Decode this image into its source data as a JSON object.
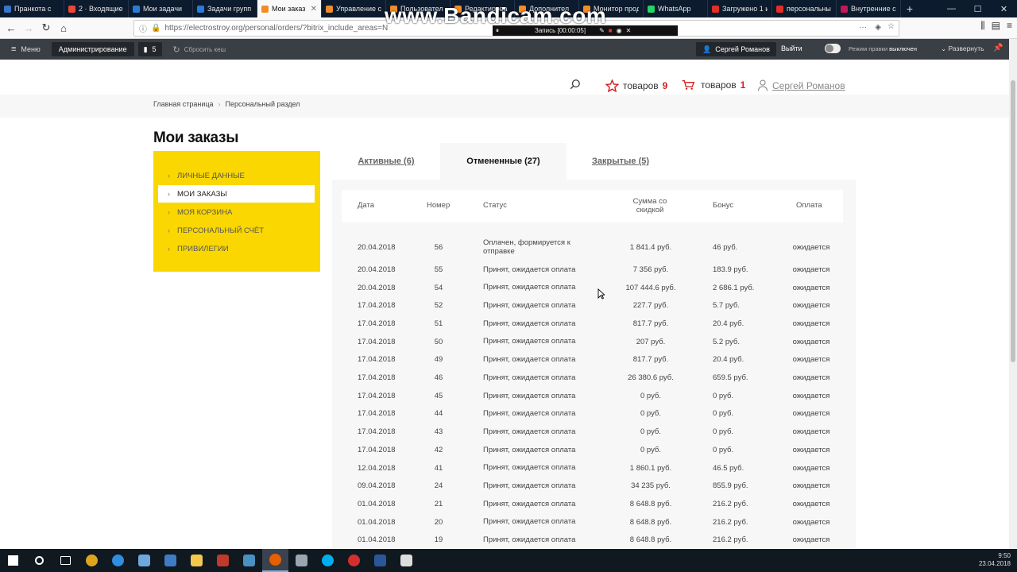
{
  "browser": {
    "tabs": [
      {
        "label": "Пранкота с",
        "color": "#3b73c8",
        "active": false
      },
      {
        "label": "2 · Входящие",
        "color": "#e9473a",
        "active": false
      },
      {
        "label": "Мои задачи",
        "color": "#2a7bd6",
        "active": false
      },
      {
        "label": "Задачи групп",
        "color": "#2a7bd6",
        "active": false
      },
      {
        "label": "Мои заказ",
        "color": "#f28c28",
        "active": true
      },
      {
        "label": "Управление с",
        "color": "#f28c28",
        "active": false
      },
      {
        "label": "Пользовател",
        "color": "#f28c28",
        "active": false
      },
      {
        "label": "Редактирова",
        "color": "#f28c28",
        "active": false
      },
      {
        "label": "Дополнител",
        "color": "#f28c28",
        "active": false
      },
      {
        "label": "Монитор прод",
        "color": "#f28c28",
        "active": false
      },
      {
        "label": "WhatsApp",
        "color": "#25d366",
        "active": false
      },
      {
        "label": "Загружено 1 и",
        "color": "#e52d27",
        "active": false
      },
      {
        "label": "персональны",
        "color": "#e52d27",
        "active": false
      },
      {
        "label": "Внутренние с",
        "color": "#c2185b",
        "active": false
      }
    ],
    "url": "https://electrostroy.org/personal/orders/?bitrix_include_areas=N",
    "watermark": "www.Bandicam.com",
    "recording": "Запись [00:00:05]"
  },
  "adminbar": {
    "menu": "Меню",
    "admin": "Администрирование",
    "count": "5",
    "cache": "Сбросить кеш",
    "user": "Сергей Романов",
    "exit": "Выйти",
    "mode_label": "Режим правки",
    "mode_value": "выключен",
    "expand": "Развернуть"
  },
  "header": {
    "fav_label": "товаров",
    "fav_count": "9",
    "cart_label": "товаров",
    "cart_count": "1",
    "user": "Сергей Романов"
  },
  "breadcrumbs": [
    "Главная страница",
    "Персональный раздел"
  ],
  "page_title": "Мои заказы",
  "sidebar": [
    {
      "label": "Личные данные",
      "active": false
    },
    {
      "label": "Мои заказы",
      "active": true
    },
    {
      "label": "Моя корзина",
      "active": false
    },
    {
      "label": "Персональный счёт",
      "active": false
    },
    {
      "label": "Привилегии",
      "active": false
    }
  ],
  "order_tabs": [
    {
      "label": "Активные (6)",
      "active": false
    },
    {
      "label": "Отмененные (27)",
      "active": true
    },
    {
      "label": "Закрытые (5)",
      "active": false
    }
  ],
  "table": {
    "headers": [
      "Дата",
      "Номер",
      "Статус",
      "Сумма со скидкой",
      "Бонус",
      "Оплата"
    ],
    "rows": [
      [
        "20.04.2018",
        "56",
        "Оплачен, формируется к отправке",
        "1 841.4 руб.",
        "46 руб.",
        "ожидается"
      ],
      [
        "20.04.2018",
        "55",
        "Принят, ожидается оплата",
        "7 356 руб.",
        "183.9 руб.",
        "ожидается"
      ],
      [
        "20.04.2018",
        "54",
        "Принят, ожидается оплата",
        "107 444.6 руб.",
        "2 686.1 руб.",
        "ожидается"
      ],
      [
        "17.04.2018",
        "52",
        "Принят, ожидается оплата",
        "227.7 руб.",
        "5.7 руб.",
        "ожидается"
      ],
      [
        "17.04.2018",
        "51",
        "Принят, ожидается оплата",
        "817.7 руб.",
        "20.4 руб.",
        "ожидается"
      ],
      [
        "17.04.2018",
        "50",
        "Принят, ожидается оплата",
        "207 руб.",
        "5.2 руб.",
        "ожидается"
      ],
      [
        "17.04.2018",
        "49",
        "Принят, ожидается оплата",
        "817.7 руб.",
        "20.4 руб.",
        "ожидается"
      ],
      [
        "17.04.2018",
        "46",
        "Принят, ожидается оплата",
        "26 380.6 руб.",
        "659.5 руб.",
        "ожидается"
      ],
      [
        "17.04.2018",
        "45",
        "Принят, ожидается оплата",
        "0 руб.",
        "0 руб.",
        "ожидается"
      ],
      [
        "17.04.2018",
        "44",
        "Принят, ожидается оплата",
        "0 руб.",
        "0 руб.",
        "ожидается"
      ],
      [
        "17.04.2018",
        "43",
        "Принят, ожидается оплата",
        "0 руб.",
        "0 руб.",
        "ожидается"
      ],
      [
        "17.04.2018",
        "42",
        "Принят, ожидается оплата",
        "0 руб.",
        "0 руб.",
        "ожидается"
      ],
      [
        "12.04.2018",
        "41",
        "Принят, ожидается оплата",
        "1 860.1 руб.",
        "46.5 руб.",
        "ожидается"
      ],
      [
        "09.04.2018",
        "24",
        "Принят, ожидается оплата",
        "34 235 руб.",
        "855.9 руб.",
        "ожидается"
      ],
      [
        "01.04.2018",
        "21",
        "Принят, ожидается оплата",
        "8 648.8 руб.",
        "216.2 руб.",
        "ожидается"
      ],
      [
        "01.04.2018",
        "20",
        "Принят, ожидается оплата",
        "8 648.8 руб.",
        "216.2 руб.",
        "ожидается"
      ],
      [
        "01.04.2018",
        "19",
        "Принят, ожидается оплата",
        "8 648.8 руб.",
        "216.2 руб.",
        "ожидается"
      ]
    ]
  },
  "taskbar": {
    "icons": [
      {
        "name": "start-icon",
        "color": "#ffffff"
      },
      {
        "name": "search-icon",
        "color": "#ffffff"
      },
      {
        "name": "task-view-icon",
        "color": "#ffffff"
      },
      {
        "name": "chrome-icon",
        "color": "#e0a41c"
      },
      {
        "name": "edge-icon",
        "color": "#2f8ee0"
      },
      {
        "name": "app-icon",
        "color": "#6fa8dc"
      },
      {
        "name": "app-icon",
        "color": "#3f7cc4"
      },
      {
        "name": "explorer-icon",
        "color": "#f2c94c"
      },
      {
        "name": "filezilla-icon",
        "color": "#c0392b"
      },
      {
        "name": "app-icon",
        "color": "#4a90c2"
      },
      {
        "name": "firefox-icon",
        "color": "#e66000"
      },
      {
        "name": "app-icon",
        "color": "#9aa5b1"
      },
      {
        "name": "skype-icon",
        "color": "#00aff0"
      },
      {
        "name": "bandicam-icon",
        "color": "#d32f2f"
      },
      {
        "name": "word-icon",
        "color": "#2b579a"
      },
      {
        "name": "photos-icon",
        "color": "#dddddd"
      }
    ],
    "time": "9:50",
    "date": "23.04.2018"
  }
}
